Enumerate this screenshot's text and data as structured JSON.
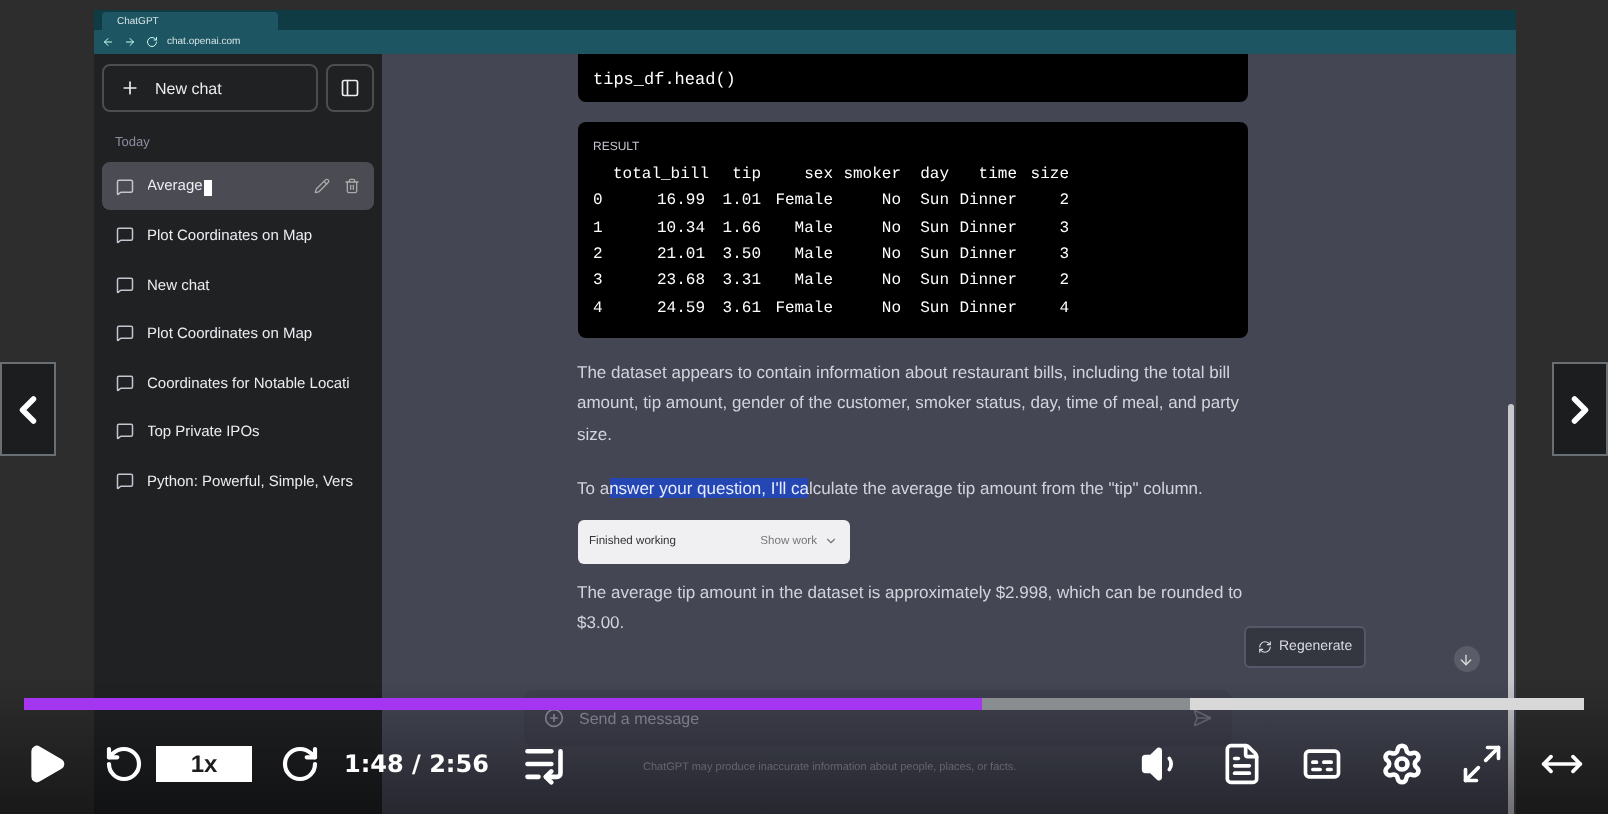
{
  "browser": {
    "tab_title": "ChatGPT",
    "address": "chat.openai.com"
  },
  "sidebar": {
    "new_chat": "New chat",
    "section": "Today",
    "items": [
      {
        "label": "Average",
        "selected": true
      },
      {
        "label": "Plot Coordinates on Map",
        "selected": false
      },
      {
        "label": "New chat",
        "selected": false
      },
      {
        "label": "Plot Coordinates on Map",
        "selected": false
      },
      {
        "label": "Coordinates for Notable Locati",
        "selected": false
      },
      {
        "label": "Top Private IPOs",
        "selected": false
      },
      {
        "label": "Python: Powerful, Simple, Vers",
        "selected": false
      }
    ]
  },
  "chat": {
    "code": "tips_df.head()",
    "result": {
      "label": "RESULT",
      "columns": [
        "",
        "total_bill",
        "tip",
        "sex",
        "smoker",
        "day",
        "time",
        "size"
      ],
      "rows": [
        [
          "0",
          "16.99",
          "1.01",
          "Female",
          "No",
          "Sun",
          "Dinner",
          "2"
        ],
        [
          "1",
          "10.34",
          "1.66",
          "Male",
          "No",
          "Sun",
          "Dinner",
          "3"
        ],
        [
          "2",
          "21.01",
          "3.50",
          "Male",
          "No",
          "Sun",
          "Dinner",
          "3"
        ],
        [
          "3",
          "23.68",
          "3.31",
          "Male",
          "No",
          "Sun",
          "Dinner",
          "2"
        ],
        [
          "4",
          "24.59",
          "3.61",
          "Female",
          "No",
          "Sun",
          "Dinner",
          "4"
        ]
      ]
    },
    "paragraph_1": "The dataset appears to contain information about restaurant bills, including the total bill amount, tip amount, gender of the customer, smoker status, day, time of meal, and party size.",
    "paragraph_2": {
      "before": "To a",
      "highlighted": "nswer your question, I'll ca",
      "after": "lculate the average tip amount from the \"tip\" column."
    },
    "work": {
      "status": "Finished working",
      "toggle": "Show work",
      "expanded": false
    },
    "paragraph_3": "The average tip amount in the dataset is approximately $2.998, which can be rounded to $3.00.",
    "regenerate": "Regenerate",
    "input_placeholder": "Send a message",
    "disclaimer": "ChatGPT may produce inaccurate information about people, places, or facts."
  },
  "player": {
    "progress": {
      "level": 0.614,
      "buffered": {
        "level": 0.748
      }
    },
    "speed": "1x",
    "time": "1:48 / 2:56",
    "playing": false
  }
}
